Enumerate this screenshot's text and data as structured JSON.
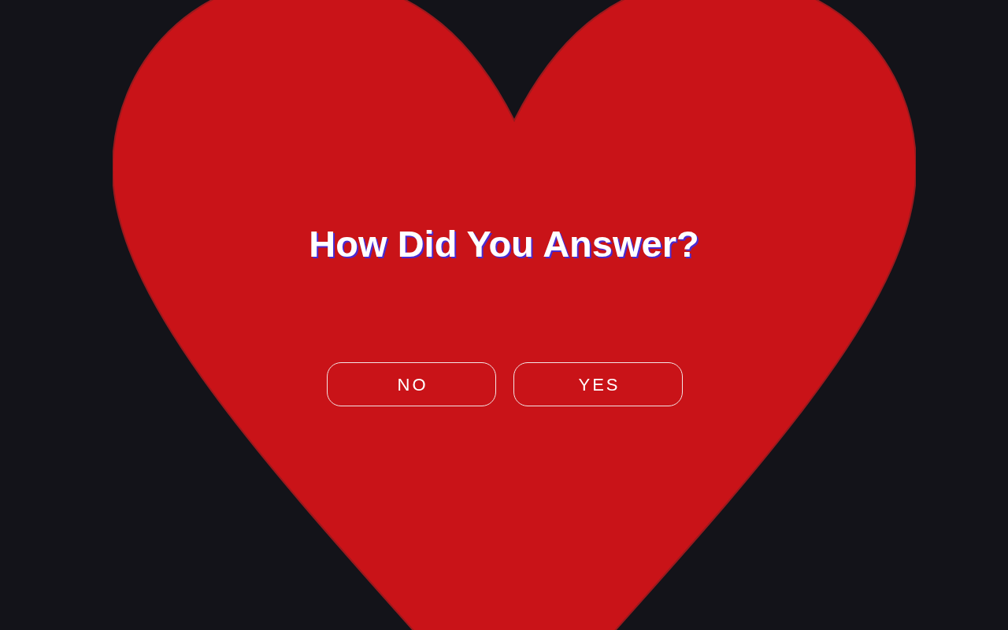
{
  "title": "How Did You Answer?",
  "buttons": [
    {
      "label": "NO"
    },
    {
      "label": "YES"
    }
  ]
}
